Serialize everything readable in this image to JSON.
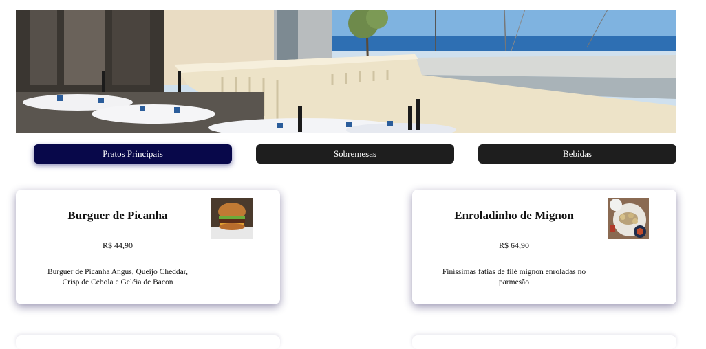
{
  "hero": {
    "image": "restaurant-terrace-photo"
  },
  "tabs": [
    {
      "label": "Pratos Principais",
      "active": true
    },
    {
      "label": "Sobremesas",
      "active": false
    },
    {
      "label": "Bebidas",
      "active": false
    }
  ],
  "menu_items": [
    {
      "title": "Burguer de Picanha",
      "price": "R$ 44,90",
      "description": "Burguer de Picanha Angus, Queijo Cheddar, Crisp de Cebola e Geléia de Bacon",
      "image": "burger-photo"
    },
    {
      "title": "Enroladinho de Mignon",
      "price": "R$ 64,90",
      "description": "Finíssimas fatias de filé mignon enroladas no parmesão",
      "image": "mignon-rolls-photo"
    }
  ],
  "colors": {
    "active_tab": "#08084a",
    "tab": "#1e1e1e",
    "card_shadow": "#3c2d78"
  }
}
